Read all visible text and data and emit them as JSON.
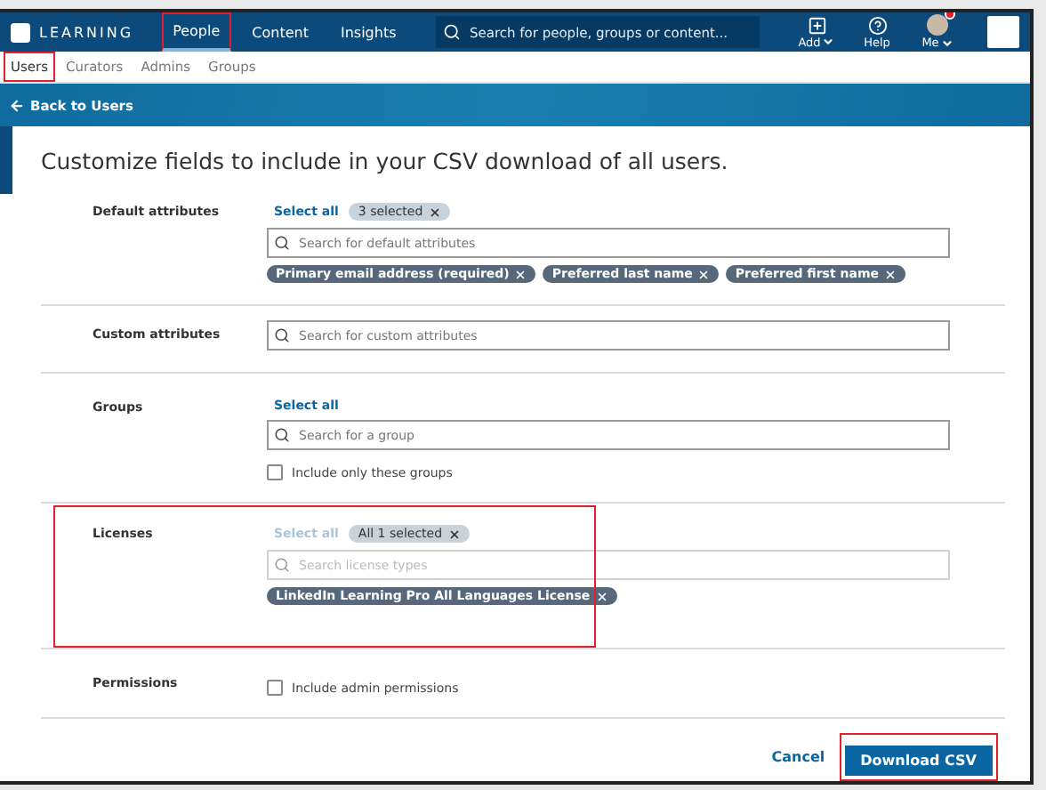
{
  "top_nav": {
    "logo_text": "LEARNING",
    "tabs": [
      {
        "label": "People",
        "selected": true,
        "highlighted": true
      },
      {
        "label": "Content",
        "selected": false,
        "highlighted": false
      },
      {
        "label": "Insights",
        "selected": false,
        "highlighted": false
      }
    ],
    "search": {
      "placeholder": "Search for people, groups or content..."
    },
    "actions": [
      {
        "kind": "add",
        "label": "Add"
      },
      {
        "kind": "help",
        "label": "Help"
      },
      {
        "kind": "me",
        "label": "Me",
        "notification": true
      }
    ]
  },
  "sub_nav": [
    {
      "label": "Users",
      "selected": true,
      "highlighted": true
    },
    {
      "label": "Curators",
      "selected": false,
      "highlighted": false
    },
    {
      "label": "Admins",
      "selected": false,
      "highlighted": false
    },
    {
      "label": "Groups",
      "selected": false,
      "highlighted": false
    }
  ],
  "back_link": "Back to Users",
  "heading": "Customize fields to include in your CSV download of all users.",
  "sections": [
    {
      "label": "Default attributes",
      "select_all": {
        "text": "Select all",
        "disabled": false
      },
      "count_chip": "3 selected",
      "field": {
        "placeholder": "Search for default attributes",
        "disabled": false
      },
      "tags": [
        "Primary email address (required)",
        "Preferred last name",
        "Preferred first name"
      ],
      "highlighted": false
    },
    {
      "label": "Custom attributes",
      "field": {
        "placeholder": "Search for custom attributes",
        "disabled": false
      },
      "highlighted": false
    },
    {
      "label": "Groups",
      "select_all": {
        "text": "Select all",
        "disabled": false
      },
      "field": {
        "placeholder": "Search for a group",
        "disabled": false
      },
      "checkbox": {
        "label": "Include only these groups",
        "checked": false
      },
      "highlighted": false
    },
    {
      "label": "Licenses",
      "select_all": {
        "text": "Select all",
        "disabled": true
      },
      "count_chip": "All 1 selected",
      "field": {
        "placeholder": "Search license types",
        "disabled": true
      },
      "tags": [
        "LinkedIn Learning Pro All Languages License"
      ],
      "highlighted": true
    },
    {
      "label": "Permissions",
      "checkbox": {
        "label": "Include admin permissions",
        "checked": false
      },
      "highlighted": false
    }
  ],
  "footer": {
    "cancel": "Cancel",
    "download": {
      "label": "Download CSV",
      "highlighted": true
    }
  }
}
